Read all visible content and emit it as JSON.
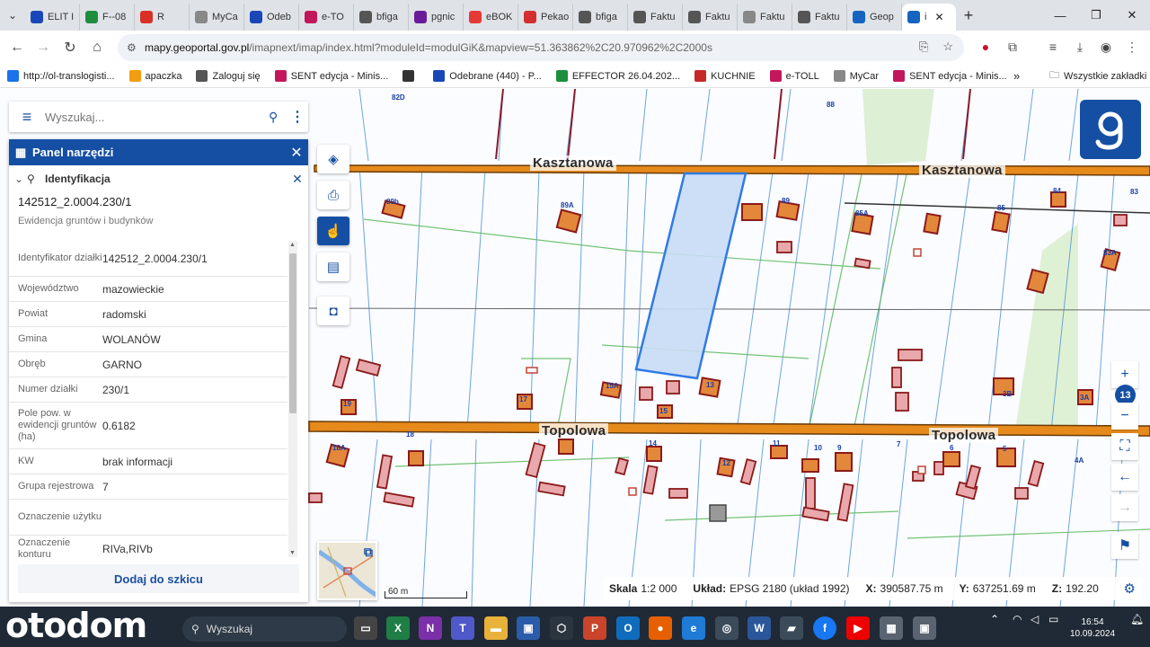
{
  "browser": {
    "tabs": [
      {
        "label": "ELIT I",
        "color": "#1a47b8",
        "active": false
      },
      {
        "label": "F--08",
        "color": "#1e8e3e",
        "active": false
      },
      {
        "label": "R",
        "color": "#d93025",
        "active": false
      },
      {
        "label": "MyCa",
        "color": "#888888",
        "active": false
      },
      {
        "label": "Odeb",
        "color": "#1a47b8",
        "active": false
      },
      {
        "label": "e-TO",
        "color": "#c2185b",
        "active": false
      },
      {
        "label": "bfiga",
        "color": "#555555",
        "active": false
      },
      {
        "label": "pgnic",
        "color": "#6a1b9a",
        "active": false
      },
      {
        "label": "eBOK",
        "color": "#e53935",
        "active": false
      },
      {
        "label": "Pekao",
        "color": "#d32f2f",
        "active": false
      },
      {
        "label": "bfiga",
        "color": "#555555",
        "active": false
      },
      {
        "label": "Faktu",
        "color": "#555555",
        "active": false
      },
      {
        "label": "Faktu",
        "color": "#555555",
        "active": false
      },
      {
        "label": "Faktu",
        "color": "#888888",
        "active": false
      },
      {
        "label": "Faktu",
        "color": "#555555",
        "active": false
      },
      {
        "label": "Geop",
        "color": "#1565c0",
        "active": false
      },
      {
        "label": "i",
        "color": "#1565c0",
        "active": true
      }
    ],
    "url_host": "mapy.geoportal.gov.pl",
    "url_path": "/imapnext/imap/index.html?moduleId=modulGiK&mapview=51.363862%2C20.970962%2C2000s",
    "bookmarks": [
      {
        "label": "http://ol-translogisti...",
        "color": "#1a73e8"
      },
      {
        "label": "apaczka",
        "color": "#f39c12"
      },
      {
        "label": "Zaloguj się",
        "color": "#555555"
      },
      {
        "label": "SENT edycja - Minis...",
        "color": "#c2185b"
      },
      {
        "label": "",
        "color": "#333333"
      },
      {
        "label": "Odebrane (440) - P...",
        "color": "#1a47b8"
      },
      {
        "label": "EFFECTOR 26.04.202...",
        "color": "#1e8e3e"
      },
      {
        "label": "KUCHNIE",
        "color": "#c62828"
      },
      {
        "label": "e-TOLL",
        "color": "#c2185b"
      },
      {
        "label": "MyCar",
        "color": "#888888"
      },
      {
        "label": "SENT edycja - Minis...",
        "color": "#c2185b"
      }
    ],
    "all_bookmarks": "Wszystkie zakładki"
  },
  "search": {
    "placeholder": "Wyszukaj..."
  },
  "panel": {
    "title": "Panel narzędzi",
    "section": "Identyfikacja",
    "parcel_id": "142512_2.0004.230/1",
    "subtitle": "Ewidencja gruntów i budynków",
    "rows": [
      {
        "key": "Identyfikator działki",
        "value": "142512_2.0004.230/1"
      },
      {
        "key": "Województwo",
        "value": "mazowieckie"
      },
      {
        "key": "Powiat",
        "value": "radomski"
      },
      {
        "key": "Gmina",
        "value": "WOLANÓW"
      },
      {
        "key": "Obręb",
        "value": "GARNO"
      },
      {
        "key": "Numer działki",
        "value": "230/1"
      },
      {
        "key": "Pole pow. w ewidencji gruntów (ha)",
        "value": "0.6182"
      },
      {
        "key": "KW",
        "value": "brak informacji"
      },
      {
        "key": "Grupa rejestrowa",
        "value": "7"
      },
      {
        "key": "Oznaczenie użytku",
        "value": ""
      },
      {
        "key": "Oznaczenie konturu",
        "value": "RIVa,RIVb"
      }
    ],
    "add_button": "Dodaj do szkicu"
  },
  "map": {
    "streets": [
      "Kasztanowa",
      "Kasztanowa",
      "Topolowa",
      "Topolowa"
    ],
    "house_numbers": [
      "82D",
      "89b",
      "89A",
      "89",
      "85A",
      "85",
      "84",
      "83",
      "83A",
      "88",
      "15A",
      "13",
      "15",
      "17",
      "19",
      "18",
      "18A",
      "14",
      "12",
      "11",
      "10",
      "9",
      "7",
      "6",
      "5",
      "4A",
      "3B",
      "3A"
    ],
    "zoom_level": "13",
    "scale_bar_label": "60 m",
    "selected_parcel_fill": "#c8dcf5",
    "selected_parcel_stroke": "#2f7ae5"
  },
  "status": {
    "scale_label": "Skala",
    "scale_value": "1:2 000",
    "crs_label": "Układ:",
    "crs_value": "EPSG 2180 (układ 1992)",
    "x_label": "X:",
    "x_value": "390587.75 m",
    "y_label": "Y:",
    "y_value": "637251.69 m",
    "z_label": "Z:",
    "z_value": "192.20"
  },
  "taskbar": {
    "brand": "otodom",
    "search_placeholder": "Wyszukaj",
    "time": "16:54",
    "date": "10.09.2024"
  }
}
